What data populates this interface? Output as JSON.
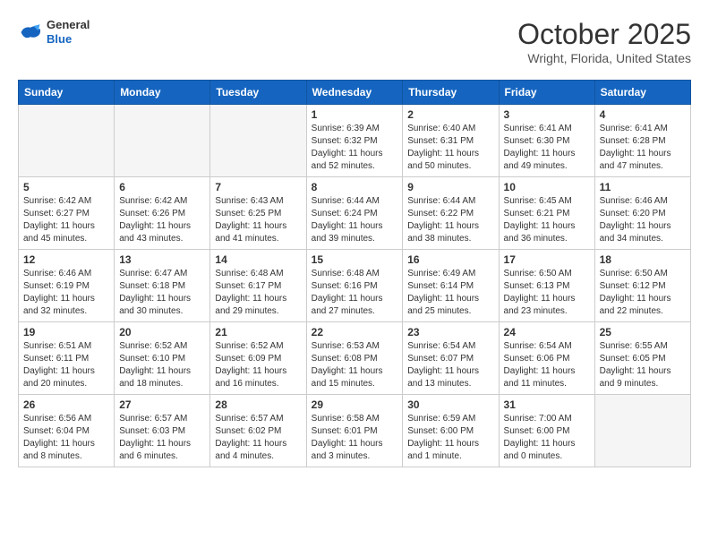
{
  "header": {
    "logo_line1": "General",
    "logo_line2": "Blue",
    "month": "October 2025",
    "location": "Wright, Florida, United States"
  },
  "weekdays": [
    "Sunday",
    "Monday",
    "Tuesday",
    "Wednesday",
    "Thursday",
    "Friday",
    "Saturday"
  ],
  "weeks": [
    [
      {
        "day": "",
        "info": ""
      },
      {
        "day": "",
        "info": ""
      },
      {
        "day": "",
        "info": ""
      },
      {
        "day": "1",
        "info": "Sunrise: 6:39 AM\nSunset: 6:32 PM\nDaylight: 11 hours\nand 52 minutes."
      },
      {
        "day": "2",
        "info": "Sunrise: 6:40 AM\nSunset: 6:31 PM\nDaylight: 11 hours\nand 50 minutes."
      },
      {
        "day": "3",
        "info": "Sunrise: 6:41 AM\nSunset: 6:30 PM\nDaylight: 11 hours\nand 49 minutes."
      },
      {
        "day": "4",
        "info": "Sunrise: 6:41 AM\nSunset: 6:28 PM\nDaylight: 11 hours\nand 47 minutes."
      }
    ],
    [
      {
        "day": "5",
        "info": "Sunrise: 6:42 AM\nSunset: 6:27 PM\nDaylight: 11 hours\nand 45 minutes."
      },
      {
        "day": "6",
        "info": "Sunrise: 6:42 AM\nSunset: 6:26 PM\nDaylight: 11 hours\nand 43 minutes."
      },
      {
        "day": "7",
        "info": "Sunrise: 6:43 AM\nSunset: 6:25 PM\nDaylight: 11 hours\nand 41 minutes."
      },
      {
        "day": "8",
        "info": "Sunrise: 6:44 AM\nSunset: 6:24 PM\nDaylight: 11 hours\nand 39 minutes."
      },
      {
        "day": "9",
        "info": "Sunrise: 6:44 AM\nSunset: 6:22 PM\nDaylight: 11 hours\nand 38 minutes."
      },
      {
        "day": "10",
        "info": "Sunrise: 6:45 AM\nSunset: 6:21 PM\nDaylight: 11 hours\nand 36 minutes."
      },
      {
        "day": "11",
        "info": "Sunrise: 6:46 AM\nSunset: 6:20 PM\nDaylight: 11 hours\nand 34 minutes."
      }
    ],
    [
      {
        "day": "12",
        "info": "Sunrise: 6:46 AM\nSunset: 6:19 PM\nDaylight: 11 hours\nand 32 minutes."
      },
      {
        "day": "13",
        "info": "Sunrise: 6:47 AM\nSunset: 6:18 PM\nDaylight: 11 hours\nand 30 minutes."
      },
      {
        "day": "14",
        "info": "Sunrise: 6:48 AM\nSunset: 6:17 PM\nDaylight: 11 hours\nand 29 minutes."
      },
      {
        "day": "15",
        "info": "Sunrise: 6:48 AM\nSunset: 6:16 PM\nDaylight: 11 hours\nand 27 minutes."
      },
      {
        "day": "16",
        "info": "Sunrise: 6:49 AM\nSunset: 6:14 PM\nDaylight: 11 hours\nand 25 minutes."
      },
      {
        "day": "17",
        "info": "Sunrise: 6:50 AM\nSunset: 6:13 PM\nDaylight: 11 hours\nand 23 minutes."
      },
      {
        "day": "18",
        "info": "Sunrise: 6:50 AM\nSunset: 6:12 PM\nDaylight: 11 hours\nand 22 minutes."
      }
    ],
    [
      {
        "day": "19",
        "info": "Sunrise: 6:51 AM\nSunset: 6:11 PM\nDaylight: 11 hours\nand 20 minutes."
      },
      {
        "day": "20",
        "info": "Sunrise: 6:52 AM\nSunset: 6:10 PM\nDaylight: 11 hours\nand 18 minutes."
      },
      {
        "day": "21",
        "info": "Sunrise: 6:52 AM\nSunset: 6:09 PM\nDaylight: 11 hours\nand 16 minutes."
      },
      {
        "day": "22",
        "info": "Sunrise: 6:53 AM\nSunset: 6:08 PM\nDaylight: 11 hours\nand 15 minutes."
      },
      {
        "day": "23",
        "info": "Sunrise: 6:54 AM\nSunset: 6:07 PM\nDaylight: 11 hours\nand 13 minutes."
      },
      {
        "day": "24",
        "info": "Sunrise: 6:54 AM\nSunset: 6:06 PM\nDaylight: 11 hours\nand 11 minutes."
      },
      {
        "day": "25",
        "info": "Sunrise: 6:55 AM\nSunset: 6:05 PM\nDaylight: 11 hours\nand 9 minutes."
      }
    ],
    [
      {
        "day": "26",
        "info": "Sunrise: 6:56 AM\nSunset: 6:04 PM\nDaylight: 11 hours\nand 8 minutes."
      },
      {
        "day": "27",
        "info": "Sunrise: 6:57 AM\nSunset: 6:03 PM\nDaylight: 11 hours\nand 6 minutes."
      },
      {
        "day": "28",
        "info": "Sunrise: 6:57 AM\nSunset: 6:02 PM\nDaylight: 11 hours\nand 4 minutes."
      },
      {
        "day": "29",
        "info": "Sunrise: 6:58 AM\nSunset: 6:01 PM\nDaylight: 11 hours\nand 3 minutes."
      },
      {
        "day": "30",
        "info": "Sunrise: 6:59 AM\nSunset: 6:00 PM\nDaylight: 11 hours\nand 1 minute."
      },
      {
        "day": "31",
        "info": "Sunrise: 7:00 AM\nSunset: 6:00 PM\nDaylight: 11 hours\nand 0 minutes."
      },
      {
        "day": "",
        "info": ""
      }
    ]
  ]
}
